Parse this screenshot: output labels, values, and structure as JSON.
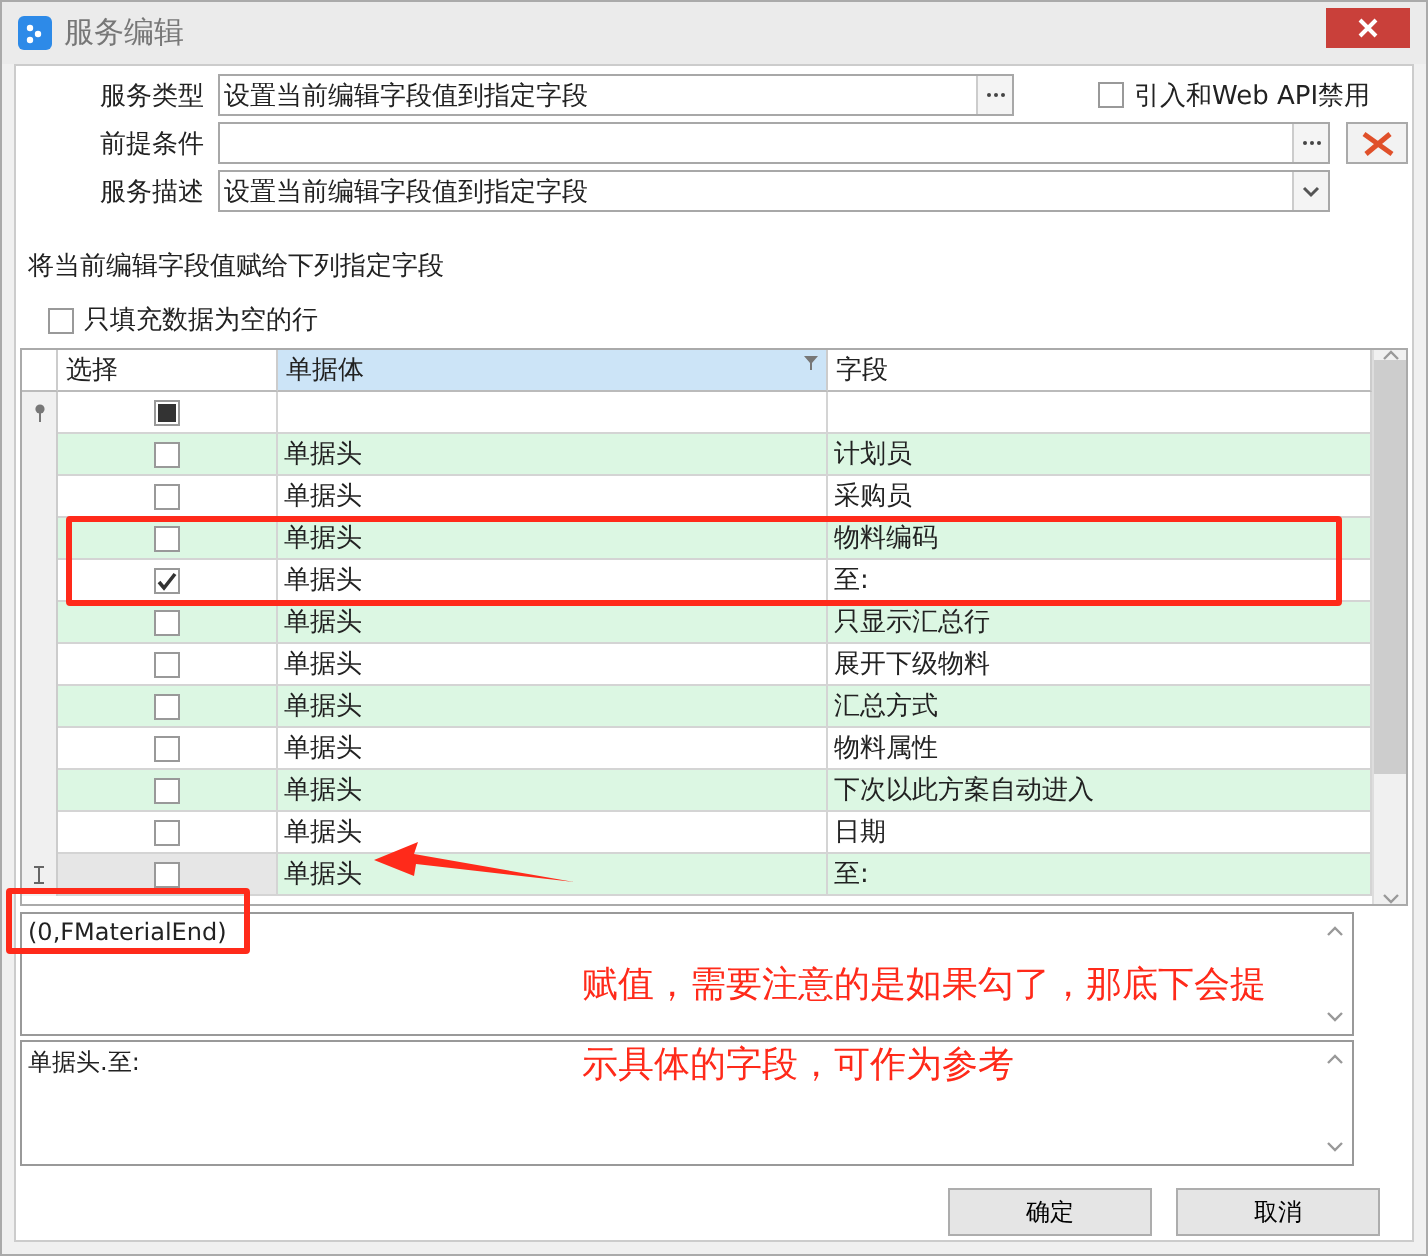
{
  "window": {
    "title": "服务编辑"
  },
  "form": {
    "fields": [
      {
        "label": "服务类型",
        "kind": "ellipsis",
        "value": "设置当前编辑字段值到指定字段"
      },
      {
        "label": "前提条件",
        "kind": "ellipsis_wide"
      },
      {
        "label": "服务描述",
        "kind": "dropdown",
        "value": "设置当前编辑字段值到指定字段"
      }
    ],
    "web_api": {
      "label": "引入和Web API禁用",
      "checked": false
    }
  },
  "instruction": "将当前编辑字段值赋给下列指定字段",
  "only_empty": {
    "label": "只填充数据为空的行",
    "checked": false
  },
  "table": {
    "columns": [
      {
        "label": "选择",
        "filtered": false
      },
      {
        "label": "单据体",
        "filtered": true
      },
      {
        "label": "字段",
        "filtered": false
      }
    ],
    "filter_row": {
      "indeterminate": true
    },
    "rows": [
      {
        "checked": false,
        "entity": "单据头",
        "field": "计划员",
        "current": false
      },
      {
        "checked": false,
        "entity": "单据头",
        "field": "采购员",
        "current": false
      },
      {
        "checked": false,
        "entity": "单据头",
        "field": "物料编码",
        "current": false
      },
      {
        "checked": true,
        "entity": "单据头",
        "field": "至:",
        "current": false
      },
      {
        "checked": false,
        "entity": "单据头",
        "field": "只显示汇总行",
        "current": false
      },
      {
        "checked": false,
        "entity": "单据头",
        "field": "展开下级物料",
        "current": false
      },
      {
        "checked": false,
        "entity": "单据头",
        "field": "汇总方式",
        "current": false
      },
      {
        "checked": false,
        "entity": "单据头",
        "field": "物料属性",
        "current": false
      },
      {
        "checked": false,
        "entity": "单据头",
        "field": "下次以此方案自动进入",
        "current": false
      },
      {
        "checked": false,
        "entity": "单据头",
        "field": "日期",
        "current": false
      },
      {
        "checked": false,
        "entity": "单据头",
        "field": "至:",
        "current": true
      }
    ]
  },
  "expression": "(0,FMaterialEnd)",
  "preview": "单据头.至:",
  "annotation": [
    "赋值，需要注意的是如果勾了，那底下会提",
    "示具体的字段，可作为参考"
  ],
  "buttons": [
    "确定",
    "取消"
  ]
}
